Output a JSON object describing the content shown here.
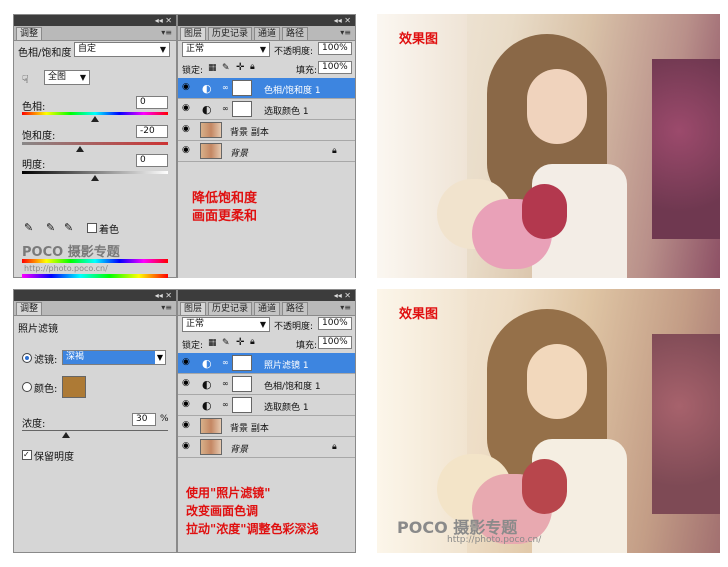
{
  "top": {
    "adjust_panel": {
      "tab": "调整",
      "preset_label": "色相/饱和度",
      "preset_value": "自定",
      "channel_value": "全图",
      "hue_label": "色相:",
      "hue_value": "0",
      "saturation_label": "饱和度:",
      "saturation_value": "-20",
      "lightness_label": "明度:",
      "lightness_value": "0",
      "colorize_label": "着色",
      "watermark_logo": "POCO 摄影专题",
      "watermark_url": "http://photo.poco.cn/"
    },
    "layers_panel": {
      "tabs": [
        "图层",
        "历史记录",
        "通道",
        "路径"
      ],
      "blend_mode": "正常",
      "opacity_label": "不透明度:",
      "opacity_value": "100%",
      "lock_label": "锁定:",
      "fill_label": "填充:",
      "fill_value": "100%",
      "layers": [
        "色相/饱和度 1",
        "选取颜色 1",
        "背景 副本",
        "背景"
      ],
      "note_line1": "降低饱和度",
      "note_line2": "画面更柔和"
    },
    "photo_caption": "效果图"
  },
  "bottom": {
    "adjust_panel": {
      "tab": "调整",
      "title": "照片滤镜",
      "filter_label": "滤镜:",
      "filter_value": "深褐",
      "color_label": "颜色:",
      "density_label": "浓度:",
      "density_value": "30",
      "density_unit": "%",
      "preserve_label": "保留明度"
    },
    "layers_panel": {
      "tabs": [
        "图层",
        "历史记录",
        "通道",
        "路径"
      ],
      "blend_mode": "正常",
      "opacity_label": "不透明度:",
      "opacity_value": "100%",
      "lock_label": "锁定:",
      "fill_label": "填充:",
      "fill_value": "100%",
      "layers": [
        "照片滤镜 1",
        "色相/饱和度 1",
        "选取颜色 1",
        "背景 副本",
        "背景"
      ],
      "note_line1": "使用\"照片滤镜\"",
      "note_line2": "改变画面色调",
      "note_line3": "拉动\"浓度\"调整色彩深浅"
    },
    "photo_caption": "效果图",
    "watermark_logo": "POCO 摄影专题",
    "watermark_url": "http://photo.poco.cn/"
  },
  "colors": {
    "selected_layer": "#3d85e0",
    "annotation_red": "#e01010",
    "filter_swatch": "#ad7a35"
  }
}
